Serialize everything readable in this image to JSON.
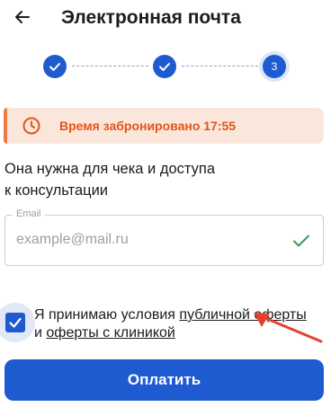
{
  "header": {
    "title": "Электронная почта",
    "back_icon": "arrow-left-icon"
  },
  "stepper": {
    "steps": [
      {
        "state": "done"
      },
      {
        "state": "done"
      },
      {
        "state": "current",
        "number": "3"
      }
    ]
  },
  "timer": {
    "text": "Время забронировано 17:55",
    "icon": "clock-icon",
    "color": "#e0561b"
  },
  "description": {
    "line1": "Она нужна для чека и доступа",
    "line2": "к консультации"
  },
  "email": {
    "label": "Email",
    "placeholder": "example@mail.ru",
    "value": "",
    "valid_icon": "check-icon"
  },
  "agreement": {
    "checked": true,
    "prefix": "Я принимаю условия ",
    "link1": "публичной оферты",
    "middle": "и ",
    "link2": "оферты с клиникой"
  },
  "pay_button": {
    "label": "Оплатить"
  },
  "colors": {
    "primary": "#1f5bd0",
    "accent": "#e0561b",
    "valid": "#2e9e5b"
  }
}
